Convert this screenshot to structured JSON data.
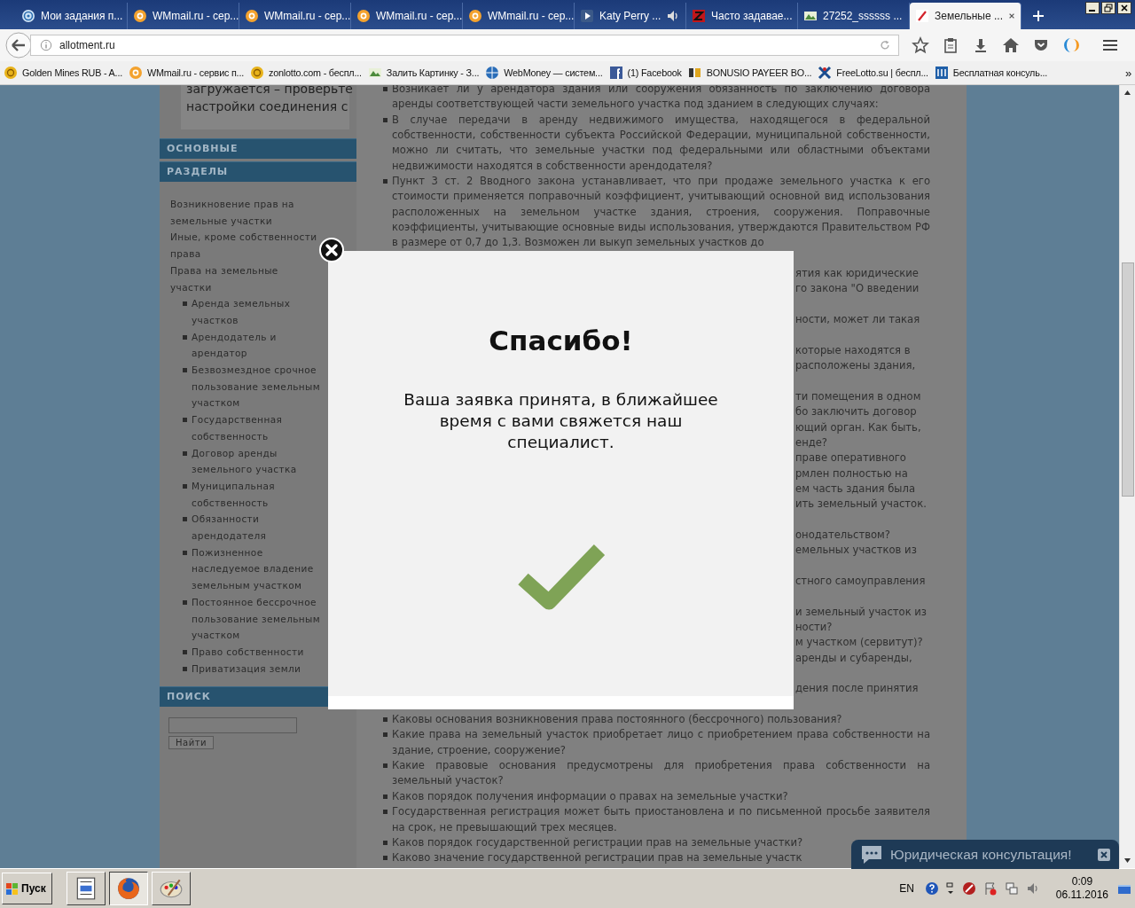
{
  "browser": {
    "tabs": [
      {
        "title": "Мои задания п...",
        "kind": "spiral",
        "audio": false,
        "selected": false
      },
      {
        "title": "WMmail.ru - сер...",
        "kind": "at",
        "audio": false,
        "selected": false
      },
      {
        "title": "WMmail.ru - сер...",
        "kind": "at",
        "audio": false,
        "selected": false
      },
      {
        "title": "WMmail.ru - сер...",
        "kind": "at",
        "audio": false,
        "selected": false
      },
      {
        "title": "WMmail.ru - сер...",
        "kind": "at",
        "audio": false,
        "selected": false
      },
      {
        "title": "Katy Perry ...",
        "kind": "play",
        "audio": true,
        "selected": false
      },
      {
        "title": "Часто задавае...",
        "kind": "z",
        "audio": false,
        "selected": false
      },
      {
        "title": "27252_ssssss ...",
        "kind": "image",
        "audio": false,
        "selected": false
      },
      {
        "title": "Земельные ...",
        "kind": "pen",
        "audio": false,
        "selected": true
      }
    ],
    "url": "allotment.ru",
    "bookmarks": [
      {
        "title": "Golden Mines RUB - A...",
        "kind": "coin"
      },
      {
        "title": "WMmail.ru - сервис п...",
        "kind": "at"
      },
      {
        "title": "zonlotto.com - беспл...",
        "kind": "coin"
      },
      {
        "title": "Залить Картинку - З...",
        "kind": "image"
      },
      {
        "title": "WebMoney — систем...",
        "kind": "globe"
      },
      {
        "title": "(1) Facebook",
        "kind": "f"
      },
      {
        "title": "BONUSIO PAYEER BO...",
        "kind": "pb"
      },
      {
        "title": "FreeLotto.su | беспл...",
        "kind": "x"
      },
      {
        "title": "Бесплатная консуль...",
        "kind": "book"
      }
    ],
    "bookmarks_more": "»"
  },
  "sidebar": {
    "notice": "загружается – проверьте настройки соединения с",
    "blocks": [
      {
        "kind": "heading",
        "title": "ОСНОВНЫЕ"
      },
      {
        "kind": "menu",
        "title": "РАЗДЕЛЫ",
        "items": [
          {
            "text": "Возникновение прав на земельные участки"
          },
          {
            "text": "Иные, кроме собственности права"
          },
          {
            "text": "Права на земельные участки",
            "children": [
              {
                "text": "Аренда земельных участков"
              },
              {
                "text": "Арендодатель и арендатор"
              },
              {
                "text": "Безвозмездное срочное пользование земельным участком"
              },
              {
                "text": "Государственная собственность"
              },
              {
                "text": "Договор аренды земельного участка"
              },
              {
                "text": "Муниципальная собственность"
              },
              {
                "text": "Обязанности арендодателя"
              },
              {
                "text": "Пожизненное наследуемое владение земельным участком"
              },
              {
                "text": "Постоянное бессрочное пользование земельным участком"
              },
              {
                "text": "Право собственности"
              },
              {
                "text": "Приватизация земли"
              }
            ]
          }
        ]
      },
      {
        "kind": "search",
        "title": "ПОИСК",
        "button": "Найти"
      }
    ]
  },
  "main": {
    "paragraphs_top": [
      "Возникает ли у арендатора здания или сооружения обязанность по заключению договора аренды соответствующей части земельного участка под зданием в следующих случаях:",
      "В случае передачи в аренду недвижимого имущества, находящегося в федеральной собственности, собственности субъекта Российской Федерации, муниципальной собственности, можно ли считать, что земельные участки под федеральными или областными объектами недвижимости находятся в собственности арендодателя?",
      "Пункт 3 ст. 2 Вводного закона устанавливает, что при продаже земельного участка к его стоимости применяется поправочный коэффициент, учитывающий основной вид использования расположенных на земельном участке здания, строения, сооружения. Поправочные коэффициенты, учитывающие основные виды использования, утверждаются Правительством РФ в размере от 0,7 до 1,3. Возможен ли выкуп земельных участков до"
    ],
    "fragments": [
      [
        "ятия как юридические",
        "го закона \"О введении"
      ],
      [
        "ности, может ли такая"
      ],
      [
        "которые находятся в",
        "расположены здания,"
      ],
      [
        "ти помещения в одном",
        "бо заключить договор",
        "ющий орган. Как быть,",
        "енде?",
        "праве оперативного",
        "рмлен полностью на",
        "ем часть здания была",
        "ить земельный участок."
      ],
      [
        "онодательством?",
        "емельных участков из"
      ],
      [
        "стного самоуправления"
      ],
      [
        "и земельный участок из",
        "ности?",
        "м участком (сервитут)?",
        "аренды и субаренды,"
      ],
      [
        "дения после принятия"
      ]
    ],
    "paragraphs_bottom": [
      "Каковы основания возникновения права постоянного (бессрочного) пользования?",
      "Какие права на земельный участок приобретает лицо с приобретением права собственности на здание, строение, сооружение?",
      "Какие правовые основания предусмотрены для приобретения права собственности на земельный участок?",
      "Каков порядок получения информации о правах на земельные участки?",
      "Государственная регистрация может быть приостановлена и по письменной просьбе заявителя на срок, не превышающий трех месяцев.",
      "Каков порядок государственной регистрации прав на земельные участки?",
      "Каково значение государственной регистрации прав на земельные участк"
    ]
  },
  "modal": {
    "title": "Спасибо!",
    "message": "Ваша заявка принята, в ближайшее время с вами свяжется наш специалист."
  },
  "chat": {
    "label": "Юридическая консультация!"
  },
  "taskbar": {
    "start": "Пуск",
    "apps": [
      {
        "kind": "document",
        "selected": false
      },
      {
        "kind": "firefox",
        "selected": true
      },
      {
        "kind": "paint",
        "selected": false
      }
    ],
    "lang": "EN",
    "time": "0:09",
    "date": "06.11.2016"
  }
}
